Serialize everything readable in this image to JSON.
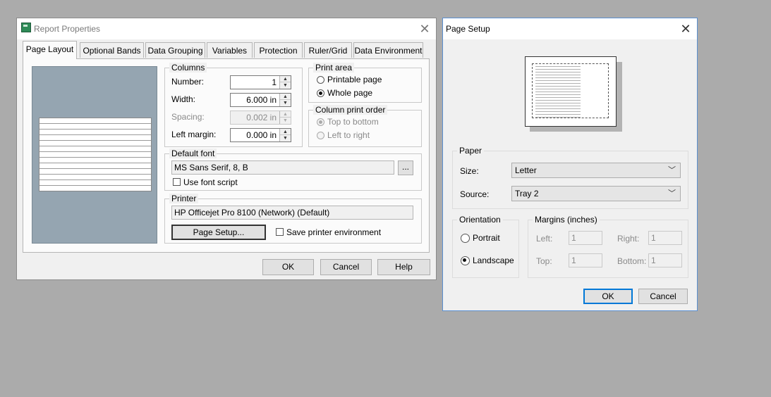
{
  "report_properties": {
    "title": "Report Properties",
    "tabs": [
      "Page Layout",
      "Optional Bands",
      "Data Grouping",
      "Variables",
      "Protection",
      "Ruler/Grid",
      "Data Environment"
    ],
    "columns": {
      "legend": "Columns",
      "number_label": "Number:",
      "number_value": "1",
      "width_label": "Width:",
      "width_value": "6.000 in",
      "spacing_label": "Spacing:",
      "spacing_value": "0.002 in",
      "left_margin_label": "Left margin:",
      "left_margin_value": "0.000 in"
    },
    "print_area": {
      "legend": "Print area",
      "option1": "Printable page",
      "option2": "Whole page",
      "selected": "Whole page"
    },
    "column_print_order": {
      "legend": "Column print order",
      "option1": "Top to bottom",
      "option2": "Left to right"
    },
    "default_font": {
      "legend": "Default font",
      "value": "MS Sans Serif, 8, B",
      "browse": "...",
      "use_font_script": "Use font script"
    },
    "printer": {
      "legend": "Printer",
      "value": "HP Officejet Pro 8100 (Network) (Default)",
      "page_setup": "Page Setup...",
      "save_env": "Save printer environment"
    },
    "buttons": {
      "ok": "OK",
      "cancel": "Cancel",
      "help": "Help"
    }
  },
  "page_setup": {
    "title": "Page Setup",
    "paper": {
      "legend": "Paper",
      "size_label": "Size:",
      "size_value": "Letter",
      "source_label": "Source:",
      "source_value": "Tray 2"
    },
    "orientation": {
      "legend": "Orientation",
      "portrait": "Portrait",
      "landscape": "Landscape",
      "selected": "Landscape"
    },
    "margins": {
      "legend": "Margins (inches)",
      "left_label": "Left:",
      "left_value": "1",
      "right_label": "Right:",
      "right_value": "1",
      "top_label": "Top:",
      "top_value": "1",
      "bottom_label": "Bottom:",
      "bottom_value": "1"
    },
    "buttons": {
      "ok": "OK",
      "cancel": "Cancel"
    }
  },
  "colors": {
    "desktop": "#ababab",
    "preview_bg": "#95a5b1",
    "ok_focus": "#0078d7"
  },
  "icons": [
    "app-icon",
    "close-icon",
    "spin-up-icon",
    "spin-down-icon",
    "chevron-down-icon"
  ]
}
